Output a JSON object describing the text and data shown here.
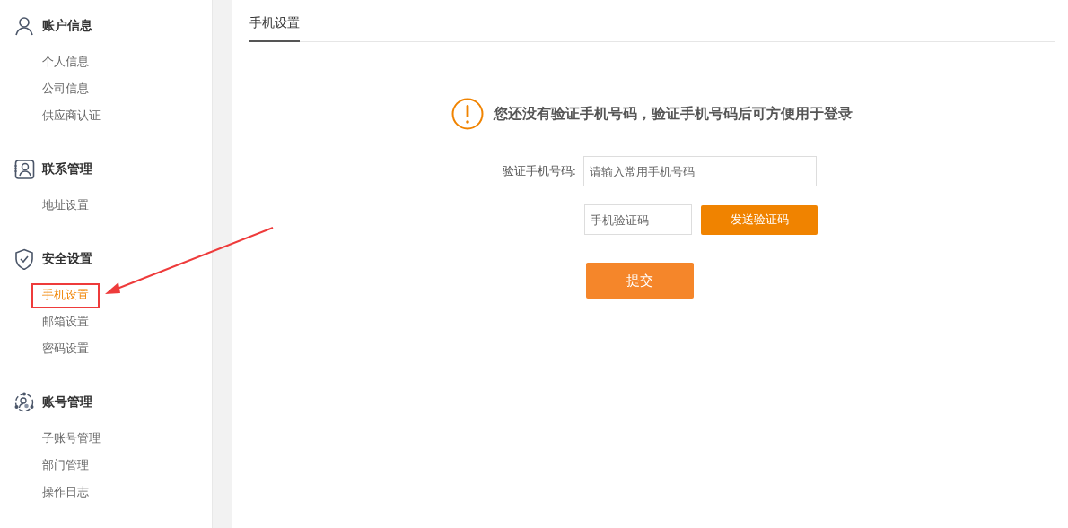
{
  "sidebar": {
    "groups": [
      {
        "title": "账户信息",
        "items": [
          {
            "label": "个人信息",
            "selected": false
          },
          {
            "label": "公司信息",
            "selected": false
          },
          {
            "label": "供应商认证",
            "selected": false
          }
        ]
      },
      {
        "title": "联系管理",
        "items": [
          {
            "label": "地址设置",
            "selected": false
          }
        ]
      },
      {
        "title": "安全设置",
        "items": [
          {
            "label": "手机设置",
            "selected": true
          },
          {
            "label": "邮箱设置",
            "selected": false
          },
          {
            "label": "密码设置",
            "selected": false
          }
        ]
      },
      {
        "title": "账号管理",
        "items": [
          {
            "label": "子账号管理",
            "selected": false
          },
          {
            "label": "部门管理",
            "selected": false
          },
          {
            "label": "操作日志",
            "selected": false
          }
        ]
      }
    ]
  },
  "tabs": [
    {
      "label": "手机设置",
      "selected": true
    }
  ],
  "notice": "您还没有验证手机号码，验证手机号码后可方便用于登录",
  "form": {
    "phone_label": "验证手机号码:",
    "phone_placeholder": "请输入常用手机号码",
    "code_placeholder": "手机验证码",
    "send_button": "发送验证码",
    "submit_button": "提交"
  }
}
